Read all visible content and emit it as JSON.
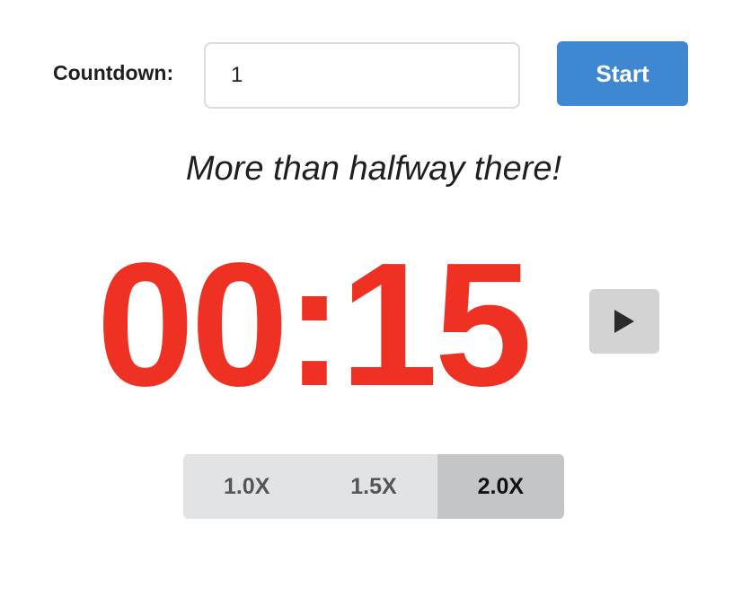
{
  "controls": {
    "countdown_label": "Countdown:",
    "countdown_value": "1",
    "start_label": "Start"
  },
  "status": {
    "message": "More than halfway there!"
  },
  "timer": {
    "display": "00:15",
    "color": "#ef3124",
    "play_icon": "play-icon"
  },
  "speed": {
    "options": [
      "1.0X",
      "1.5X",
      "2.0X"
    ],
    "selected": "2.0X"
  },
  "colors": {
    "accent": "#3f87d1",
    "timer": "#ef3124",
    "speed_active_bg": "#c4c5c6"
  }
}
